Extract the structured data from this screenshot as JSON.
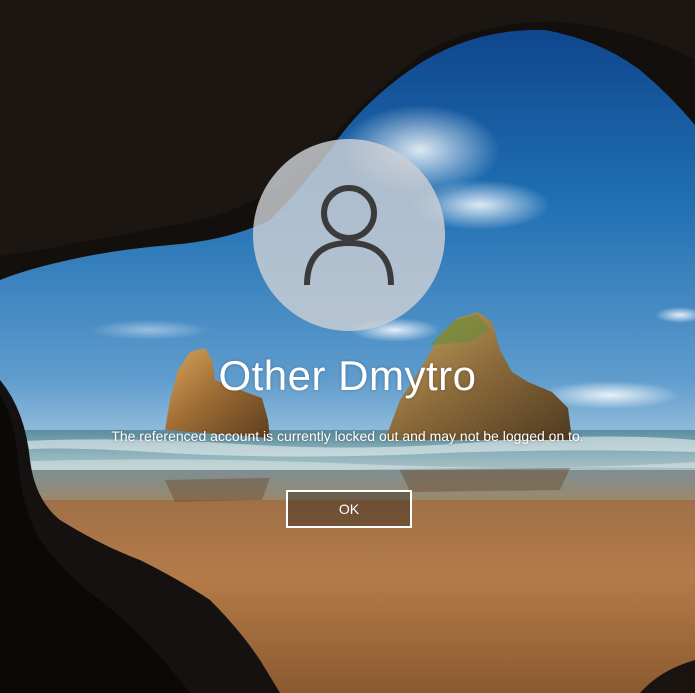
{
  "lock_screen": {
    "account_name": "Other Dmytro",
    "message": "The referenced account is currently locked out and may not be logged on to.",
    "ok_label": "OK",
    "avatar_icon": "user-silhouette-icon"
  },
  "colors": {
    "text": "#ffffff",
    "avatar_background": "#cdd0d4",
    "avatar_glyph": "#3b3b3b",
    "button_border": "#ffffff"
  }
}
